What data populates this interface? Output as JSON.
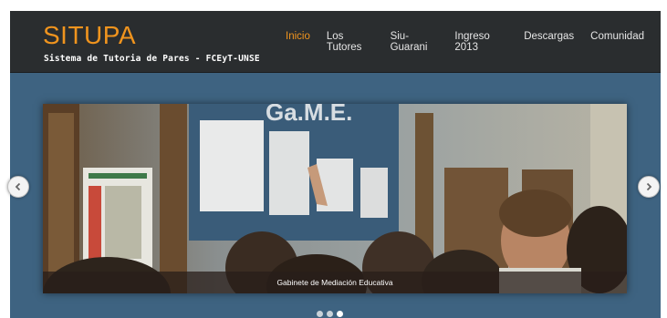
{
  "header": {
    "brand": "SITUPA",
    "tagline": "Sistema de Tutoria de Pares - FCEyT-UNSE"
  },
  "nav": {
    "items": [
      {
        "label": "Inicio",
        "active": true
      },
      {
        "label": "Los Tutores",
        "active": false
      },
      {
        "label": "Siu-Guarani",
        "active": false
      },
      {
        "label": "Ingreso 2013",
        "active": false
      },
      {
        "label": "Descargas",
        "active": false
      },
      {
        "label": "Comunidad",
        "active": false
      }
    ]
  },
  "slider": {
    "caption": "Gabinete de Mediación Educativa",
    "board_text": "Ga.M.E.",
    "slides_count": 3,
    "active_slide": 3
  },
  "colors": {
    "accent": "#f0941e",
    "header_bg": "#2a2d2f",
    "page_bg": "#3e6381"
  }
}
